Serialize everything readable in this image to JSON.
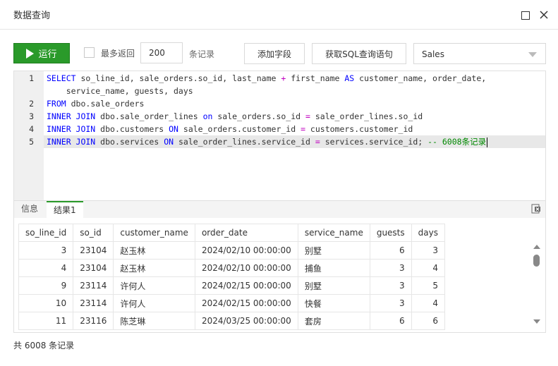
{
  "window": {
    "title": "数据查询"
  },
  "toolbar": {
    "run_label": "运行",
    "max_return_label": "最多返回",
    "limit_value": "200",
    "limit_suffix": "条记录",
    "add_field_label": "添加字段",
    "get_sql_label": "获取SQL查询语句",
    "database": "Sales"
  },
  "editor": {
    "lines": [
      {
        "number": "1",
        "tokens": [
          {
            "t": "SELECT",
            "c": "kw"
          },
          {
            "t": " so_line_id, sale_orders.so_id, last_name ",
            "c": "id"
          },
          {
            "t": "+",
            "c": "op"
          },
          {
            "t": " first_name ",
            "c": "id"
          },
          {
            "t": "AS",
            "c": "kw"
          },
          {
            "t": " customer_name, order_date,",
            "c": "id"
          }
        ]
      },
      {
        "number": "",
        "tokens": [
          {
            "t": "    service_name, guests, days",
            "c": "id"
          }
        ]
      },
      {
        "number": "2",
        "tokens": [
          {
            "t": "FROM",
            "c": "kw"
          },
          {
            "t": " dbo.sale_orders",
            "c": "id"
          }
        ]
      },
      {
        "number": "3",
        "tokens": [
          {
            "t": "INNER JOIN",
            "c": "kw"
          },
          {
            "t": " dbo.sale_order_lines ",
            "c": "id"
          },
          {
            "t": "on",
            "c": "kw"
          },
          {
            "t": " sale_orders.so_id ",
            "c": "id"
          },
          {
            "t": "=",
            "c": "op"
          },
          {
            "t": " sale_order_lines.so_id",
            "c": "id"
          }
        ]
      },
      {
        "number": "4",
        "tokens": [
          {
            "t": "INNER JOIN",
            "c": "kw"
          },
          {
            "t": " dbo.customers ",
            "c": "id"
          },
          {
            "t": "ON",
            "c": "kw"
          },
          {
            "t": " sale_orders.customer_id ",
            "c": "id"
          },
          {
            "t": "=",
            "c": "op"
          },
          {
            "t": " customers.customer_id",
            "c": "id"
          }
        ]
      },
      {
        "number": "5",
        "tokens": [
          {
            "t": "INNER JOIN",
            "c": "kw"
          },
          {
            "t": " dbo.services ",
            "c": "id"
          },
          {
            "t": "ON",
            "c": "kw"
          },
          {
            "t": " sale_order_lines.service_id ",
            "c": "id"
          },
          {
            "t": "=",
            "c": "op"
          },
          {
            "t": " services.service_id; ",
            "c": "id"
          },
          {
            "t": "-- 6008条记录",
            "c": "cm"
          }
        ]
      }
    ]
  },
  "tabs": {
    "info": "信息",
    "result": "结果1"
  },
  "results": {
    "columns": [
      "so_line_id",
      "so_id",
      "customer_name",
      "order_date",
      "service_name",
      "guests",
      "days"
    ],
    "rows": [
      [
        "3",
        "23104",
        "赵玉林",
        "2024/02/10 00:00:00",
        "别墅",
        "6",
        "3"
      ],
      [
        "4",
        "23104",
        "赵玉林",
        "2024/02/10 00:00:00",
        "捕鱼",
        "3",
        "4"
      ],
      [
        "9",
        "23114",
        "许何人",
        "2024/02/15 00:00:00",
        "别墅",
        "3",
        "5"
      ],
      [
        "10",
        "23114",
        "许何人",
        "2024/02/15 00:00:00",
        "快餐",
        "3",
        "4"
      ],
      [
        "11",
        "23116",
        "陈芝琳",
        "2024/03/25 00:00:00",
        "套房",
        "6",
        "6"
      ]
    ]
  },
  "status": {
    "text": "共 6008 条记录"
  }
}
